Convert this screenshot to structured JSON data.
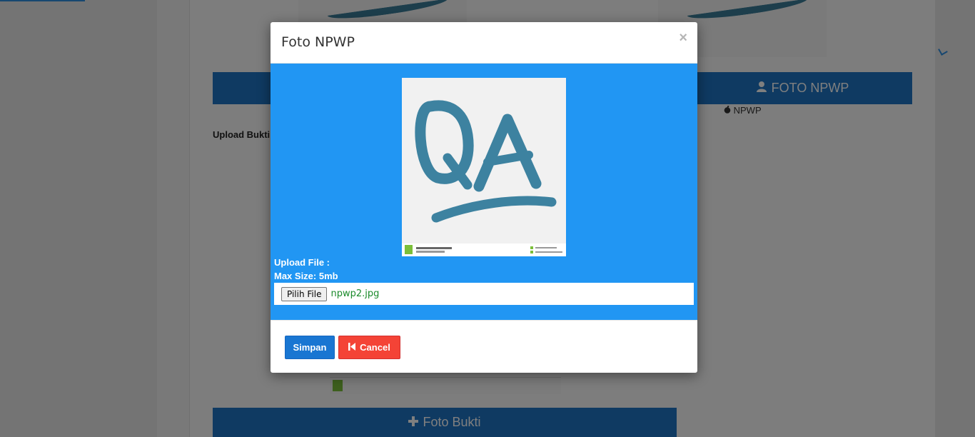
{
  "background": {
    "button_foto_npwp": "FOTO NPWP",
    "caption_npwp": "NPWP",
    "label_upload_bukti": "Upload Bukti",
    "button_foto_bukti": "Foto Bukti"
  },
  "modal": {
    "title": "Foto NPWP",
    "close_symbol": "×",
    "upload_label": "Upload File :",
    "max_size_label": "Max Size: 5mb",
    "file_button_label": "Pilih File",
    "file_name": "npwp2.jpg",
    "save_label": "Simpan",
    "cancel_label": "Cancel"
  },
  "colors": {
    "modal_body": "#2196f3",
    "save_button": "#1976d2",
    "cancel_button": "#f44336",
    "file_name": "#1a8a2a",
    "bg_button": "#1e74c4"
  },
  "icons": {
    "bg_foto_npwp": "user-icon",
    "bg_npwp": "apple-icon",
    "bg_foto_bukti": "plus-icon",
    "cancel": "step-backward-icon",
    "close": "close-icon"
  }
}
